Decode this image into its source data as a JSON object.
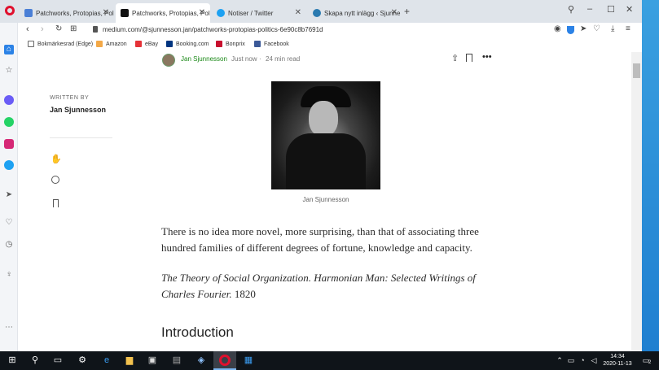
{
  "tabs": [
    {
      "title": "Patchworks, Protopias, Poli",
      "active": false
    },
    {
      "title": "Patchworks, Protopias, Poli",
      "active": true
    },
    {
      "title": "Notiser / Twitter",
      "active": false
    },
    {
      "title": "Skapa nytt inlägg ‹ Sjunne",
      "active": false
    }
  ],
  "address": {
    "url": "medium.com/@sjunnesson.jan/patchworks-protopias-politics-6e90c8b7691d"
  },
  "bookmarks": [
    "Bokmärkesrad (Edge)",
    "Amazon",
    "eBay",
    "Booking.com",
    "Bonprix",
    "Facebook"
  ],
  "article": {
    "author": "Jan Sjunnesson",
    "meta_time": "Just now",
    "meta_read": "24 min read",
    "written_by_label": "WRITTEN BY",
    "written_by_name": "Jan Sjunnesson",
    "image_caption": "Jan Sjunnesson",
    "quote_text": "There is no idea more novel, more surprising, than that of associating three hundred families of different degrees of fortune, knowledge and capacity.",
    "source_italic": "The Theory of Social Organization. Harmonian Man: Selected Writings of Charles Fourier.",
    "source_year": "1820",
    "heading": "Introduction"
  },
  "taskbar": {
    "time": "14:34",
    "date": "2020-11-13",
    "notif_count": "2"
  }
}
